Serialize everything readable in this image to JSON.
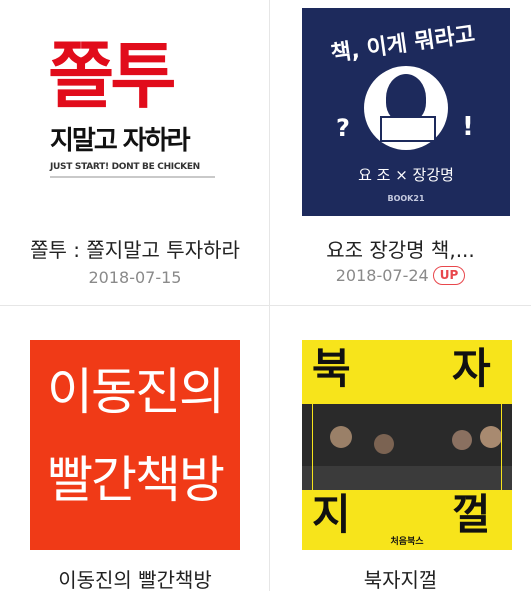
{
  "podcasts": [
    {
      "title": "쫄투 : 쫄지말고 투자하라",
      "date": "2018-07-15",
      "badge": "",
      "cover": {
        "big": "쫄투",
        "line": "지말고 자하라",
        "sub": "JUST START! DONT BE CHICKEN",
        "accent": "#e10c1b"
      }
    },
    {
      "title": "요조 장강명 책,...",
      "date": "2018-07-24",
      "badge": "UP",
      "cover": {
        "arc": "책, 이게 뭐라고",
        "q": "?",
        "ex": "!",
        "hosts": "요 조 × 장강명",
        "brand": "BOOK21",
        "bg": "#1d2a5c"
      }
    },
    {
      "title": "이동진의 빨간책방",
      "date": "",
      "badge": "",
      "cover": {
        "line1": "이동진의",
        "line2": "빨간책방",
        "bg": "#f03a17"
      }
    },
    {
      "title": "북자지껄",
      "date": "",
      "badge": "",
      "cover": {
        "c1": "북",
        "c2": "자",
        "c3": "지",
        "c4": "껄",
        "brand": "처음북스",
        "bg": "#f7e41b"
      }
    }
  ]
}
